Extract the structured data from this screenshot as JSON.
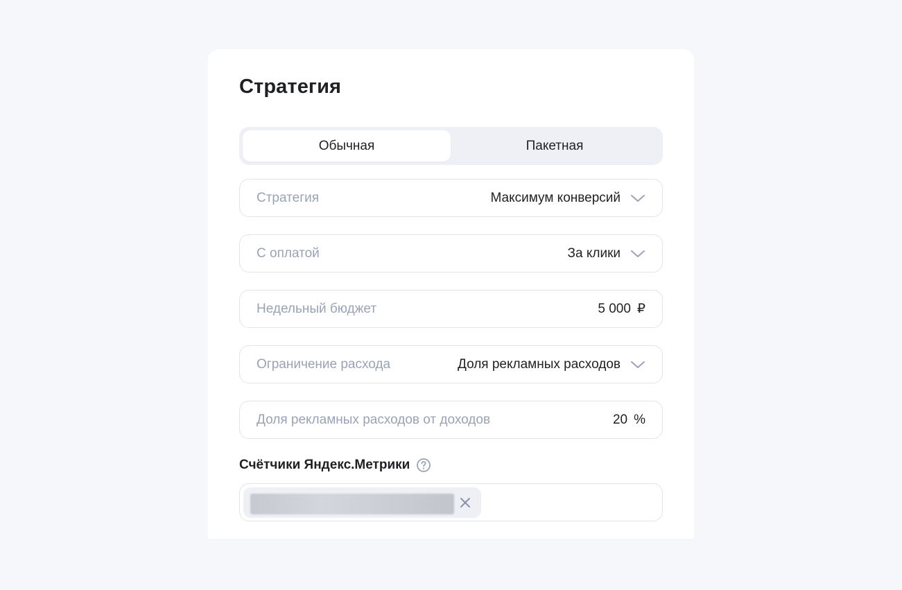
{
  "page": {
    "title": "Стратегия"
  },
  "strategy_type_tabs": [
    {
      "label": "Обычная",
      "selected": true
    },
    {
      "label": "Пакетная",
      "selected": false
    }
  ],
  "fields": {
    "strategy": {
      "label": "Стратегия",
      "value": "Максимум конверсий",
      "icon": "chevron-down-icon"
    },
    "payment": {
      "label": "С оплатой",
      "value": "За клики",
      "icon": "chevron-down-icon"
    },
    "weekly_budget": {
      "label": "Недельный бюджет",
      "value": "5 000",
      "unit": "₽"
    },
    "spend_limit": {
      "label": "Ограничение расхода",
      "value": "Доля рекламных расходов",
      "icon": "chevron-down-icon"
    },
    "ad_spend_share": {
      "label": "Доля рекламных расходов от доходов",
      "value": "20",
      "unit": "%"
    }
  },
  "metrika_counters": {
    "label": "Счётчики Яндекс.Метрики",
    "help_icon": "question-circle-icon",
    "chips": [
      {
        "text": "",
        "blurred": true,
        "close_icon": "close-icon"
      }
    ]
  },
  "colors": {
    "background": "#f6f7fa",
    "card": "#ffffff",
    "segment_bg": "#eef0f5",
    "label_gray": "#9aa3b5",
    "text": "#1f2023",
    "border": "#e2e4ea"
  }
}
